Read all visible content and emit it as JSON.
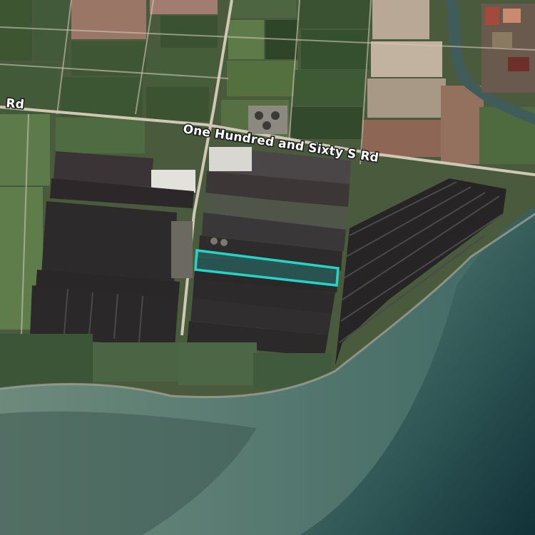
{
  "map": {
    "view": "satellite",
    "colors": {
      "highlight": "#27d3c6",
      "road": "#d8d2c0",
      "pond_dark": "#2b2829",
      "sea_deep": "#133a3f",
      "sea_shallow": "#4d6f67",
      "field_green": "#3f5a33",
      "field_brown": "#8a6a55"
    },
    "labels": {
      "main_road": "One Hundred and Sixty S Rd",
      "west_road_fragment": "Rd"
    },
    "highlighted_parcel": {
      "name": "selected-pond-parcel"
    }
  }
}
